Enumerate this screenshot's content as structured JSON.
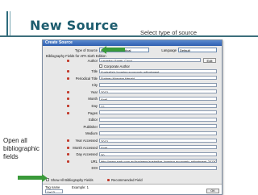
{
  "slide": {
    "title": "New Source",
    "annotation_top": "Select type of source",
    "annotation_left": "Open all bibliographic fields",
    "arrow_color": "#3a9a3a"
  },
  "dialog": {
    "title": "Create Source",
    "type_label": "Type of Source",
    "type_value": "Article in a Periodical",
    "language_label": "Language",
    "language_value": "Default",
    "section_label": "Bibliography Fields for APA Sixth Edition",
    "author_label": "Author",
    "author_value": "Lewellyn-Smith, Caryl",
    "edit_label": "Edit",
    "corporate_label": "Corporate Author",
    "fields": [
      {
        "label": "Title",
        "value": "Australia's looming economic adjustment"
      },
      {
        "label": "Periodical Title",
        "value": "Sydney Morning Herald"
      },
      {
        "label": "City",
        "value": ""
      },
      {
        "label": "Year",
        "value": "2013"
      },
      {
        "label": "Month",
        "value": "April"
      },
      {
        "label": "Day",
        "value": "22"
      },
      {
        "label": "Pages",
        "value": ""
      },
      {
        "label": "Editor",
        "value": ""
      },
      {
        "label": "Publisher",
        "value": ""
      },
      {
        "label": "Medium",
        "value": ""
      },
      {
        "label": "Year Accessed",
        "value": "2013"
      },
      {
        "label": "Month Accessed",
        "value": "April"
      },
      {
        "label": "Day Accessed",
        "value": "30"
      },
      {
        "label": "URL",
        "value": "http://www.smh.com.au/business/australias-looming-economic-adjustment-201304"
      },
      {
        "label": "DOI",
        "value": ""
      }
    ],
    "show_all_label": "Show All Bibliography Fields",
    "recommended_label": "Recommended Field",
    "tag_name_label": "Tag name",
    "tag_value": "Lle13",
    "example_label": "Example: 1",
    "ok_label": "OK"
  }
}
